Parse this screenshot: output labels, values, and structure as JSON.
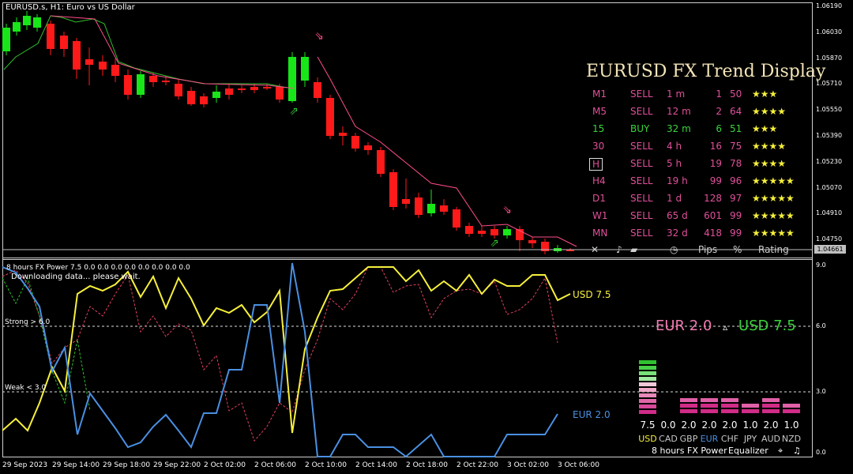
{
  "header": {
    "symbol_label": "EURUSD.s, H1:  Euro vs US Dollar"
  },
  "price_axis": [
    "1.06190",
    "1.06030",
    "1.05870",
    "1.05710",
    "1.05550",
    "1.05390",
    "1.05230",
    "1.05070",
    "1.04910",
    "1.04750"
  ],
  "current_price": "1.04661",
  "trend_panel": {
    "title": "EURUSD FX Trend Display",
    "rows": [
      {
        "tf": "M1",
        "signal": "SELL",
        "duration": "1 m",
        "pips": "1",
        "pct": "50",
        "stars": "★★★",
        "color": "#e0509a",
        "tf_color": "#e0509a"
      },
      {
        "tf": "M5",
        "signal": "SELL",
        "duration": "12 m",
        "pips": "2",
        "pct": "64",
        "stars": "★★★★",
        "color": "#e0509a",
        "tf_color": "#e0509a"
      },
      {
        "tf": "15",
        "signal": "BUY",
        "duration": "32 m",
        "pips": "6",
        "pct": "51",
        "stars": "★★★",
        "color": "#3bd43b",
        "tf_color": "#3bd43b"
      },
      {
        "tf": "30",
        "signal": "SELL",
        "duration": "4 h",
        "pips": "16",
        "pct": "75",
        "stars": "★★★★",
        "color": "#e0509a",
        "tf_color": "#e0509a"
      },
      {
        "tf": "H",
        "signal": "SELL",
        "duration": "5 h",
        "pips": "19",
        "pct": "78",
        "stars": "★★★★",
        "color": "#e0509a",
        "tf_color": "#e0509a"
      },
      {
        "tf": "H4",
        "signal": "SELL",
        "duration": "19 h",
        "pips": "99",
        "pct": "96",
        "stars": "★★★★★",
        "color": "#e0509a",
        "tf_color": "#e0509a"
      },
      {
        "tf": "D1",
        "signal": "SELL",
        "duration": "1 d",
        "pips": "128",
        "pct": "97",
        "stars": "★★★★★",
        "color": "#e0509a",
        "tf_color": "#e0509a"
      },
      {
        "tf": "W1",
        "signal": "SELL",
        "duration": "65 d",
        "pips": "601",
        "pct": "99",
        "stars": "★★★★★",
        "color": "#e0509a",
        "tf_color": "#e0509a"
      },
      {
        "tf": "MN",
        "signal": "SELL",
        "duration": "32 d",
        "pips": "418",
        "pct": "99",
        "stars": "★★★★★",
        "color": "#e0509a",
        "tf_color": "#e0509a"
      }
    ],
    "footer": {
      "close": "✕",
      "pips": "Pips",
      "pct": "%",
      "rating": "Rating"
    }
  },
  "indicator": {
    "title": "8 hours FX Power 7.5  0.0  0.0  0.0  0.0  0.0  0.0  0.0  0.0",
    "status": "Downloading data... please wait.",
    "strong_label": "Strong > 6.0",
    "weak_label": "Weak < 3.0",
    "axis": [
      "9.0",
      "6.0",
      "3.0",
      "0.0"
    ],
    "usd_label": "USD 7.5",
    "eur_label": "EUR 2.0",
    "pair_eur": "EUR 2.0",
    "pair_arrow": "▵",
    "pair_usd": "USD 7.5",
    "usd_color": "#f6f03b",
    "eur_color": "#4a90e2"
  },
  "equalizer": {
    "values": [
      "7.5",
      "0.0",
      "2.0",
      "2.0",
      "2.0",
      "1.0",
      "2.0",
      "1.0"
    ],
    "currencies": [
      "USD",
      "CAD",
      "GBP",
      "EUR",
      "CHF",
      "JPY",
      "AUD",
      "NZD"
    ],
    "currency_colors": [
      "#f6f03b",
      "#c8c8c8",
      "#c8c8c8",
      "#4a90e2",
      "#c8c8c8",
      "#c8c8c8",
      "#c8c8c8",
      "#c8c8c8"
    ],
    "footer": {
      "period": "8 hours",
      "name": "FX Power",
      "mode": "Equalizer"
    }
  },
  "time_axis": [
    "29 Sep 2023",
    "29 Sep 14:00",
    "29 Sep 18:00",
    "29 Sep 22:00",
    "2 Oct 02:00",
    "2 Oct 06:00",
    "2 Oct 10:00",
    "2 Oct 14:00",
    "2 Oct 18:00",
    "2 Oct 22:00",
    "3 Oct 02:00",
    "3 Oct 06:00"
  ]
}
